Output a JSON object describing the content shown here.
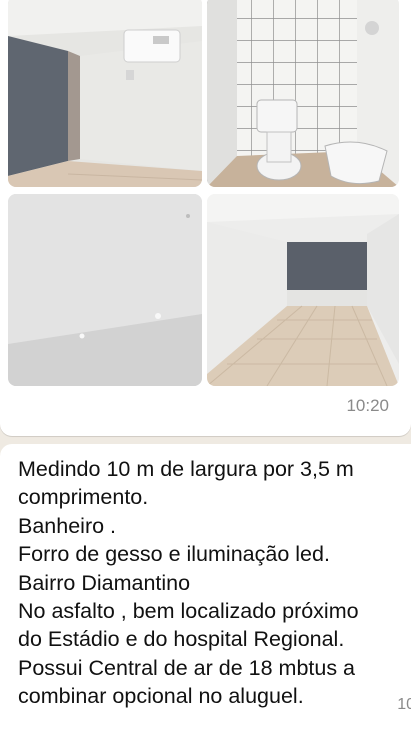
{
  "colors": {
    "chat_background": "#efeae2",
    "bubble": "#ffffff",
    "text": "#111111",
    "timestamp": "#8a8a8a"
  },
  "media_message": {
    "photos": [
      {
        "name": "living-room-with-air-conditioner"
      },
      {
        "name": "bathroom-with-toilet-and-sink"
      },
      {
        "name": "plaster-ceiling"
      },
      {
        "name": "long-room-with-tiled-floor"
      }
    ],
    "time": "10:20"
  },
  "text_message": {
    "lines": [
      "Medindo 10 m de largura por 3,5 m",
      "comprimento.",
      "Banheiro .",
      "Forro de gesso e iluminação led.",
      "Bairro Diamantino",
      "No asfalto , bem localizado próximo",
      "do Estádio e do hospital Regional.",
      "Possui Central de ar de 18 mbtus a",
      "combinar opcional no aluguel."
    ],
    "time": "10"
  }
}
